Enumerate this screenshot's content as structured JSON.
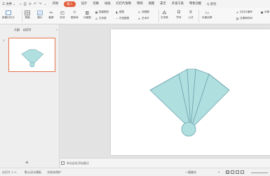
{
  "menubar": {
    "file": "三 文件",
    "file_arrow": "⌄",
    "quick_access": [
      "⌂",
      "⎙",
      "⊙",
      "↶",
      "↷",
      "⌄"
    ],
    "tabs": [
      "开始",
      "插入",
      "设计",
      "切换",
      "动画",
      "幻灯片放映",
      "审阅",
      "视图",
      "安全",
      "开发工具",
      "特色功能"
    ],
    "active_tab": "插入",
    "search": "Q 查找"
  },
  "ribbon": {
    "new_slide": "新建幻灯片",
    "table": "表格",
    "image": "图片",
    "screenshot": "截屏",
    "shapes": "形状",
    "icons": "图标库",
    "funny": "功能图",
    "smartart": "智能图形",
    "chart": "图表",
    "textbox": "文本框",
    "online_chart": "在线图表",
    "flowchart": "流程图",
    "art": "艺术字",
    "symbol": "符号",
    "formula": "公式",
    "header_footer": "页眉页脚",
    "slide_number": "幻灯片编号",
    "date_time": "日期和时间",
    "object": "对象",
    "accent": "#e25d3a"
  },
  "leftpanel": {
    "tabs": [
      "大纲",
      "幻灯片"
    ],
    "active_tab": "幻灯片",
    "slide_number": "1",
    "add_button": "+",
    "collapse": "«"
  },
  "slide": {
    "fan_fill": "#b0dfe0",
    "fan_stroke": "#6ea5ad"
  },
  "notes": {
    "placeholder": "单击此处添加备注"
  },
  "statusbar": {
    "slide_counter": "幻灯片 1 / 1",
    "theme": "默认设计模板",
    "protect": "文档未保护",
    "beautify": "一键美化",
    "notes_toggle": "≡"
  }
}
